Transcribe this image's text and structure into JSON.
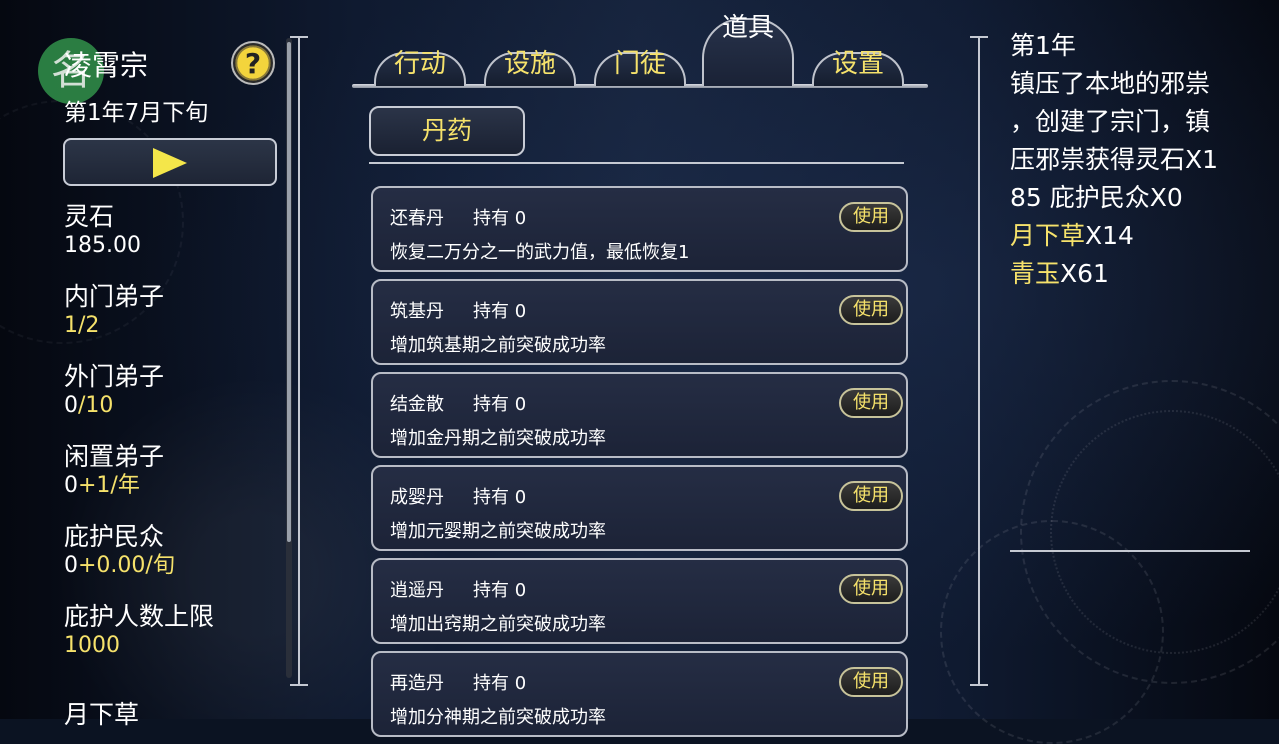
{
  "sect": {
    "avatar_char": "名",
    "name": "凌霄宗",
    "date": "第1年7月下旬"
  },
  "help_label": "?",
  "stats": [
    {
      "label": "灵石",
      "value": [
        {
          "text": "185.00",
          "color": "#ffffff"
        }
      ]
    },
    {
      "label": "内门弟子",
      "value": [
        {
          "text": "1/2",
          "color": "#f6e26b"
        }
      ]
    },
    {
      "label": "外门弟子",
      "value": [
        {
          "text": "0",
          "color": "#ffffff"
        },
        {
          "text": "/10",
          "color": "#f6e26b"
        }
      ]
    },
    {
      "label": "闲置弟子",
      "value": [
        {
          "text": "0",
          "color": "#ffffff"
        },
        {
          "text": "+1/年",
          "color": "#f6e26b"
        }
      ]
    },
    {
      "label": "庇护民众",
      "value": [
        {
          "text": "0",
          "color": "#ffffff"
        },
        {
          "text": "+0.00/旬",
          "color": "#f6e26b"
        }
      ]
    },
    {
      "label": "庇护人数上限",
      "value": [
        {
          "text": "1000",
          "color": "#f6e26b"
        }
      ]
    },
    {
      "label": "月下草",
      "value": []
    }
  ],
  "tabs": [
    {
      "label": "行动",
      "active": false
    },
    {
      "label": "设施",
      "active": false
    },
    {
      "label": "门徒",
      "active": false
    },
    {
      "label": "道具",
      "active": true
    },
    {
      "label": "设置",
      "active": false
    }
  ],
  "category": "丹药",
  "items": [
    {
      "name": "还春丹",
      "hold": "持有 0",
      "desc": "恢复二万分之一的武力值，最低恢复1",
      "use": "使用"
    },
    {
      "name": "筑基丹",
      "hold": "持有 0",
      "desc": "增加筑基期之前突破成功率",
      "use": "使用"
    },
    {
      "name": "结金散",
      "hold": "持有 0",
      "desc": "增加金丹期之前突破成功率",
      "use": "使用"
    },
    {
      "name": "成婴丹",
      "hold": "持有 0",
      "desc": "增加元婴期之前突破成功率",
      "use": "使用"
    },
    {
      "name": "逍遥丹",
      "hold": "持有 0",
      "desc": "增加出窍期之前突破成功率",
      "use": "使用"
    },
    {
      "name": "再造丹",
      "hold": "持有 0",
      "desc": "增加分神期之前突破成功率",
      "use": "使用"
    }
  ],
  "log": [
    {
      "text": "第1年",
      "color": "#ffffff"
    },
    {
      "text": "镇压了本地的邪祟",
      "color": "#ffffff"
    },
    {
      "text": "，创建了宗门，镇",
      "color": "#ffffff"
    },
    {
      "text": "压邪祟获得灵石X1",
      "color": "#ffffff"
    },
    {
      "text": "85 庇护民众X0",
      "color": "#ffffff"
    },
    {
      "parts": [
        {
          "text": "月下草",
          "color": "#f6e26b"
        },
        {
          "text": "X14",
          "color": "#ffffff"
        }
      ]
    },
    {
      "parts": [
        {
          "text": "青玉",
          "color": "#f6e26b"
        },
        {
          "text": "X61",
          "color": "#ffffff"
        }
      ]
    }
  ]
}
